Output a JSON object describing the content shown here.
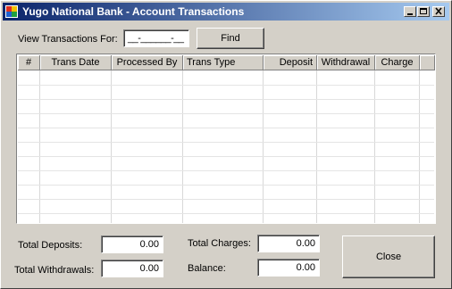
{
  "window": {
    "title": "Yugo National Bank - Account Transactions"
  },
  "filter": {
    "label": "View Transactions For:",
    "date_value": "__-______-__",
    "find_label": "Find"
  },
  "grid": {
    "columns": [
      "#",
      "Trans Date",
      "Processed By",
      "Trans Type",
      "Deposit",
      "Withdrawal",
      "Charge"
    ],
    "rows": []
  },
  "totals": {
    "deposits_label": "Total Deposits:",
    "deposits_value": "0.00",
    "withdrawals_label": "Total Withdrawals:",
    "withdrawals_value": "0.00",
    "charges_label": "Total Charges:",
    "charges_value": "0.00",
    "balance_label": "Balance:",
    "balance_value": "0.00"
  },
  "close_label": "Close"
}
